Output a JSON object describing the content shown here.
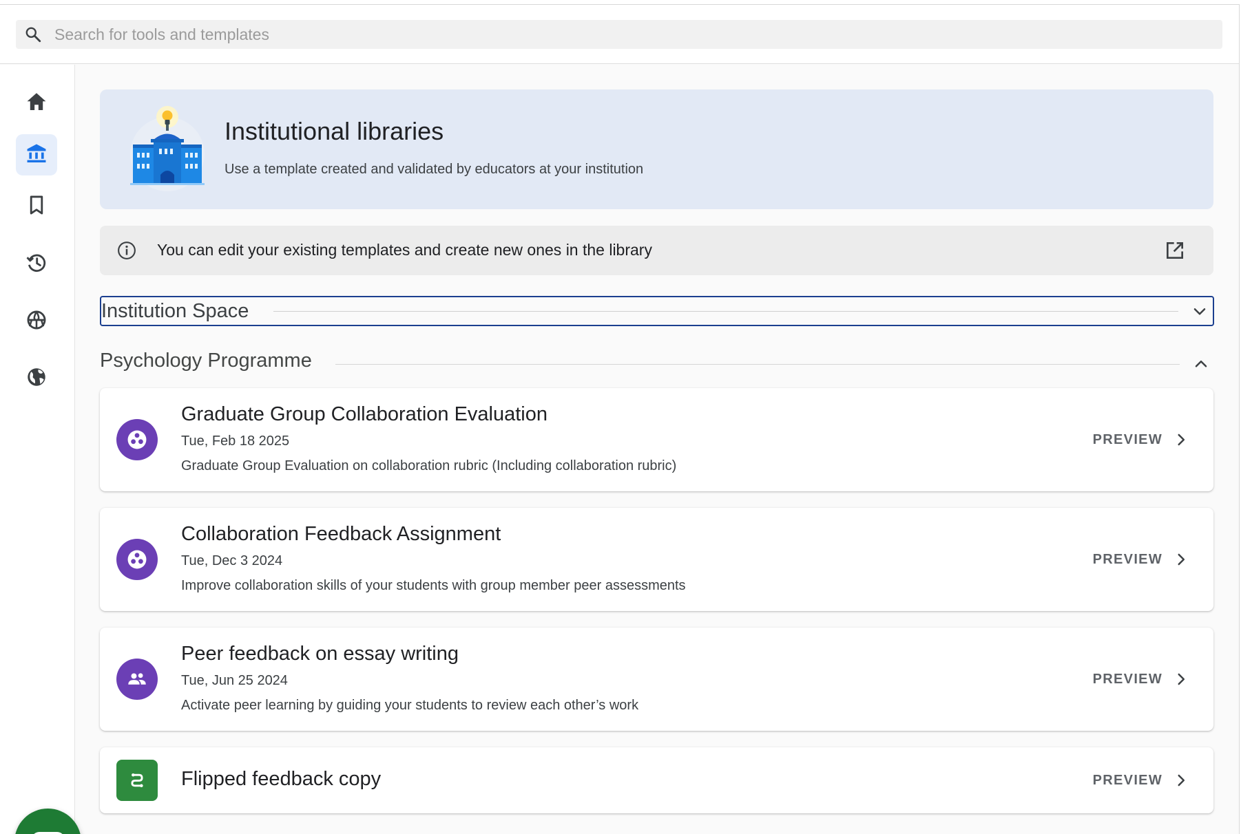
{
  "search": {
    "placeholder": "Search for tools and templates"
  },
  "sidebar": {
    "items": [
      {
        "name": "home",
        "icon": "home-icon",
        "active": false
      },
      {
        "name": "institutional-libraries",
        "icon": "institution-icon",
        "active": true
      },
      {
        "name": "bookmarks",
        "icon": "bookmark-icon",
        "active": false
      },
      {
        "name": "history",
        "icon": "history-icon",
        "active": false
      },
      {
        "name": "community",
        "icon": "community-icon",
        "active": false
      },
      {
        "name": "public",
        "icon": "globe-icon",
        "active": false
      }
    ],
    "active_background": "#e6eefb",
    "accent": "#1a73e8"
  },
  "hero": {
    "title": "Institutional libraries",
    "subtitle": "Use a template created and validated by educators at your institution",
    "illustration": "institution-building-lightbulb",
    "background": "#e2e9f5"
  },
  "info_banner": {
    "text": "You can edit your existing templates and create new ones in the library",
    "icon": "info-icon",
    "action_icon": "open-in-new-icon"
  },
  "space_select": {
    "value": "Institution Space",
    "border_color": "#1b3f8f"
  },
  "section": {
    "title": "Psychology Programme",
    "expanded": true
  },
  "templates": [
    {
      "title": "Graduate Group Collaboration Evaluation",
      "date": "Tue, Feb 18 2025",
      "description": "Graduate Group Evaluation on collaboration rubric (Including collaboration rubric)",
      "icon": "group-evaluation-icon",
      "icon_color": "#6b3fb5",
      "action": "PREVIEW"
    },
    {
      "title": "Collaboration Feedback Assignment",
      "date": "Tue, Dec 3 2024",
      "description": "Improve collaboration skills of your students with group member peer assessments",
      "icon": "group-evaluation-icon",
      "icon_color": "#6b3fb5",
      "action": "PREVIEW"
    },
    {
      "title": "Peer feedback on essay writing",
      "date": "Tue, Jun 25 2024",
      "description": "Activate peer learning by guiding your students to review each other’s work",
      "icon": "people-icon",
      "icon_color": "#6b3fb5",
      "action": "PREVIEW"
    },
    {
      "title": "Flipped feedback copy",
      "icon": "flipped-feedback-icon",
      "icon_color": "#2e8b3e",
      "action": "PREVIEW"
    }
  ],
  "chat": {
    "icon": "chat-bubble-icon",
    "color": "#1e7b34"
  }
}
